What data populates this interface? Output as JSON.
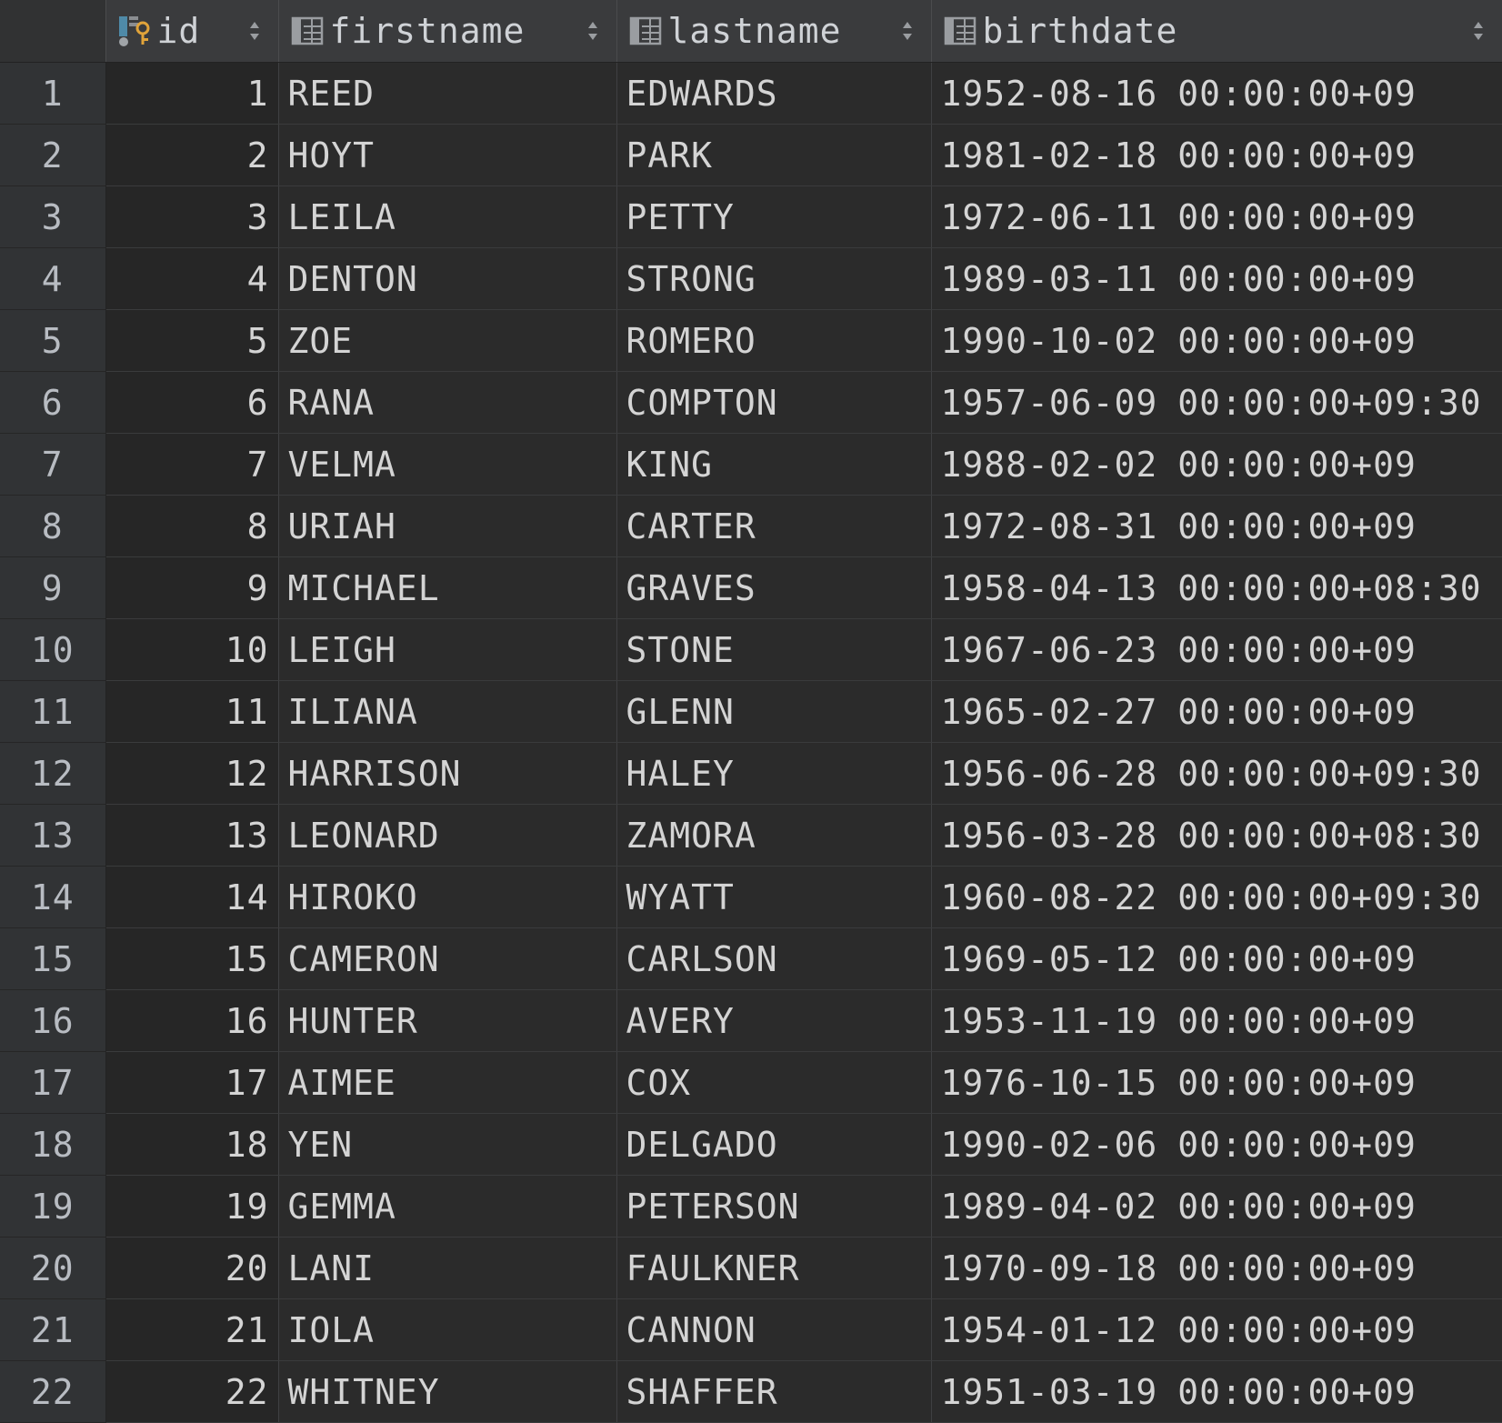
{
  "columns": {
    "id": {
      "label": "id",
      "icon": "primary-key-column-icon"
    },
    "firstname": {
      "label": "firstname",
      "icon": "column-icon"
    },
    "lastname": {
      "label": "lastname",
      "icon": "column-icon"
    },
    "birthdate": {
      "label": "birthdate",
      "icon": "column-icon"
    }
  },
  "rows": [
    {
      "row": "1",
      "id": "1",
      "firstname": "REED",
      "lastname": "EDWARDS",
      "date": "1952-08-16",
      "time": "00:00:00+09"
    },
    {
      "row": "2",
      "id": "2",
      "firstname": "HOYT",
      "lastname": "PARK",
      "date": "1981-02-18",
      "time": "00:00:00+09"
    },
    {
      "row": "3",
      "id": "3",
      "firstname": "LEILA",
      "lastname": "PETTY",
      "date": "1972-06-11",
      "time": "00:00:00+09"
    },
    {
      "row": "4",
      "id": "4",
      "firstname": "DENTON",
      "lastname": "STRONG",
      "date": "1989-03-11",
      "time": "00:00:00+09"
    },
    {
      "row": "5",
      "id": "5",
      "firstname": "ZOE",
      "lastname": "ROMERO",
      "date": "1990-10-02",
      "time": "00:00:00+09"
    },
    {
      "row": "6",
      "id": "6",
      "firstname": "RANA",
      "lastname": "COMPTON",
      "date": "1957-06-09",
      "time": "00:00:00+09:30"
    },
    {
      "row": "7",
      "id": "7",
      "firstname": "VELMA",
      "lastname": "KING",
      "date": "1988-02-02",
      "time": "00:00:00+09"
    },
    {
      "row": "8",
      "id": "8",
      "firstname": "URIAH",
      "lastname": "CARTER",
      "date": "1972-08-31",
      "time": "00:00:00+09"
    },
    {
      "row": "9",
      "id": "9",
      "firstname": "MICHAEL",
      "lastname": "GRAVES",
      "date": "1958-04-13",
      "time": "00:00:00+08:30"
    },
    {
      "row": "10",
      "id": "10",
      "firstname": "LEIGH",
      "lastname": "STONE",
      "date": "1967-06-23",
      "time": "00:00:00+09"
    },
    {
      "row": "11",
      "id": "11",
      "firstname": "ILIANA",
      "lastname": "GLENN",
      "date": "1965-02-27",
      "time": "00:00:00+09"
    },
    {
      "row": "12",
      "id": "12",
      "firstname": "HARRISON",
      "lastname": "HALEY",
      "date": "1956-06-28",
      "time": "00:00:00+09:30"
    },
    {
      "row": "13",
      "id": "13",
      "firstname": "LEONARD",
      "lastname": "ZAMORA",
      "date": "1956-03-28",
      "time": "00:00:00+08:30"
    },
    {
      "row": "14",
      "id": "14",
      "firstname": "HIROKO",
      "lastname": "WYATT",
      "date": "1960-08-22",
      "time": "00:00:00+09:30"
    },
    {
      "row": "15",
      "id": "15",
      "firstname": "CAMERON",
      "lastname": "CARLSON",
      "date": "1969-05-12",
      "time": "00:00:00+09"
    },
    {
      "row": "16",
      "id": "16",
      "firstname": "HUNTER",
      "lastname": "AVERY",
      "date": "1953-11-19",
      "time": "00:00:00+09"
    },
    {
      "row": "17",
      "id": "17",
      "firstname": "AIMEE",
      "lastname": "COX",
      "date": "1976-10-15",
      "time": "00:00:00+09"
    },
    {
      "row": "18",
      "id": "18",
      "firstname": "YEN",
      "lastname": "DELGADO",
      "date": "1990-02-06",
      "time": "00:00:00+09"
    },
    {
      "row": "19",
      "id": "19",
      "firstname": "GEMMA",
      "lastname": "PETERSON",
      "date": "1989-04-02",
      "time": "00:00:00+09"
    },
    {
      "row": "20",
      "id": "20",
      "firstname": "LANI",
      "lastname": "FAULKNER",
      "date": "1970-09-18",
      "time": "00:00:00+09"
    },
    {
      "row": "21",
      "id": "21",
      "firstname": "IOLA",
      "lastname": "CANNON",
      "date": "1954-01-12",
      "time": "00:00:00+09"
    },
    {
      "row": "22",
      "id": "22",
      "firstname": "WHITNEY",
      "lastname": "SHAFFER",
      "date": "1951-03-19",
      "time": "00:00:00+09"
    }
  ]
}
